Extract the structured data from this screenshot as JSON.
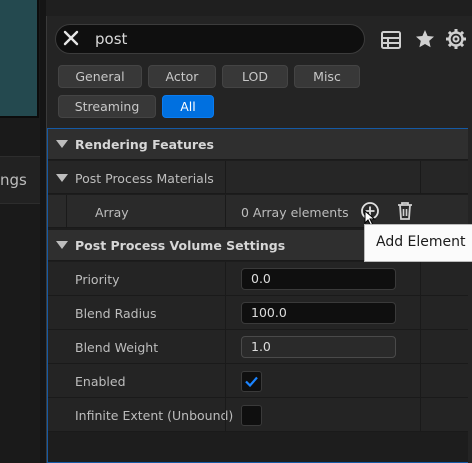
{
  "left_panel": {
    "tab_label": "ngs"
  },
  "search": {
    "value": "post"
  },
  "toolbar": {
    "icons": [
      "grid-icon",
      "star-icon",
      "gear-icon"
    ]
  },
  "filters": {
    "chips": [
      {
        "label": "General",
        "active": false
      },
      {
        "label": "Actor",
        "active": false
      },
      {
        "label": "LOD",
        "active": false
      },
      {
        "label": "Misc",
        "active": false
      },
      {
        "label": "Streaming",
        "active": false
      },
      {
        "label": "All",
        "active": true
      }
    ]
  },
  "sections": {
    "rendering_features": "Rendering Features",
    "post_process_materials": "Post Process Materials",
    "array_label": "Array",
    "array_value": "0 Array elements",
    "post_process_volume_settings": "Post Process Volume Settings"
  },
  "properties": {
    "priority": {
      "label": "Priority",
      "value": "0.0"
    },
    "blend_radius": {
      "label": "Blend Radius",
      "value": "100.0"
    },
    "blend_weight": {
      "label": "Blend Weight",
      "value": "1.0"
    },
    "enabled": {
      "label": "Enabled",
      "checked": true
    },
    "infinite_extent": {
      "label": "Infinite Extent (Unbound)",
      "checked": false
    }
  },
  "tooltip": {
    "text": "Add Element"
  },
  "colors": {
    "accent": "#0070e0",
    "panel": "#242424",
    "category": "#2f2f2f",
    "viewport": "#24494f"
  }
}
